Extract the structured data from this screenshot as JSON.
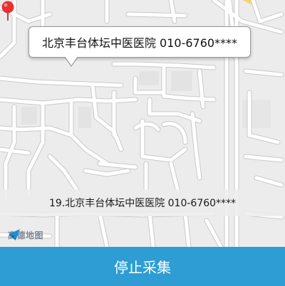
{
  "map": {
    "callout_text": "北京丰台体坛中医医院 010-6760****",
    "result_label": "19.北京丰台体坛中医医院 010-6760****",
    "logo_text": "高德地图",
    "pin_icon": "map-pin-icon",
    "logo_icon": "amap-arrow-icon"
  },
  "footer": {
    "stop_label": "停止采集"
  },
  "colors": {
    "accent": "#2e9dd3",
    "pin": "#e8302f",
    "road_outline": "#c9c9c9",
    "road_fill": "#ffffff",
    "map_background": "#ececec"
  }
}
